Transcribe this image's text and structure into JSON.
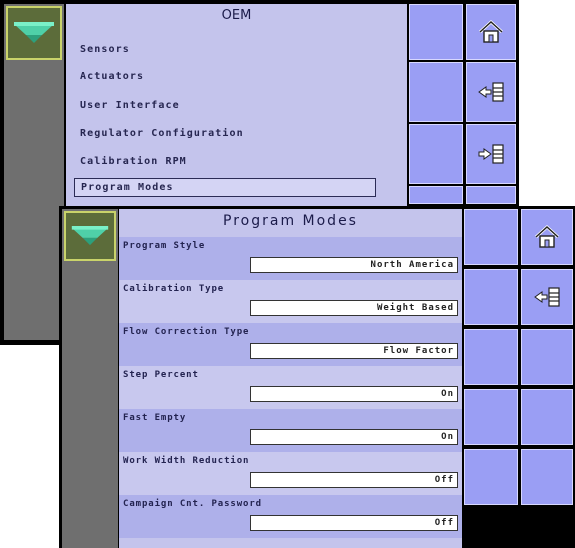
{
  "back_screen": {
    "title": "OEM",
    "menu_items": [
      "Sensors",
      "Actuators",
      "User Interface",
      "Regulator Configuration",
      "Calibration RPM",
      "Program Modes"
    ],
    "selected_index": 5,
    "side_buttons": [
      "home-icon",
      "back-list-icon",
      "forward-list-icon"
    ]
  },
  "front_screen": {
    "title": "Program Modes",
    "settings": [
      {
        "label": "Program Style",
        "value": "North America"
      },
      {
        "label": "Calibration Type",
        "value": "Weight Based"
      },
      {
        "label": "Flow Correction Type",
        "value": "Flow Factor"
      },
      {
        "label": "Step Percent",
        "value": "On"
      },
      {
        "label": "Fast Empty",
        "value": "On"
      },
      {
        "label": "Work Width Reduction",
        "value": "Off"
      },
      {
        "label": "Campaign Cnt. Password",
        "value": "Off"
      }
    ],
    "side_buttons": [
      "home-icon",
      "back-list-icon"
    ]
  },
  "colors": {
    "list_bg": "#c4c4ec",
    "row_dark": "#aeb0ea",
    "button": "#9a9ef4",
    "logo_bg": "#5c6c3a"
  }
}
